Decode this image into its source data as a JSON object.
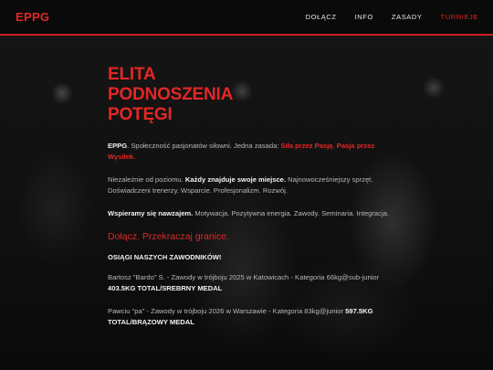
{
  "header": {
    "logo": "EPPG",
    "nav": [
      {
        "label": "DOŁĄCZ"
      },
      {
        "label": "INFO"
      },
      {
        "label": "ZASADY"
      },
      {
        "label": "TURNIEJE"
      }
    ],
    "active_nav": "TURNIEJE",
    "accent_color": "#e32726"
  },
  "hero": {
    "title_lines": [
      "ELITA",
      "PODNOSZENIA",
      "POTĘGI"
    ],
    "intro": {
      "brand": "EPPG",
      "text": ". Społeczność pasjonatów siłowni. Jedna zasada: ",
      "highlight": "Siła przez Pasję. Pasja przez Wysiłek."
    },
    "level": {
      "text_before": "Niezależnie od poziomu. ",
      "bold": "Każdy znajduje swoje miejsce.",
      "text_after": " Najnowocześniejszy sprzęt. Doświadczeni trenerzy. Wsparcie. Profesjonalizm. Rozwój."
    },
    "support": {
      "bold": "Wspieramy się nawzajem.",
      "text_after": " Motywacja. Pozytywna energia. Zawody. Seminaria. Integracja."
    },
    "tagline": "Dołącz. Przekraczaj granice.",
    "achievements_title": "OSIĄGI NASZYCH ZAWODNIKÓW!",
    "achievements": [
      {
        "text": "Bartosz \"Bardo\" S. - Zawody w trójboju 2025 w Katowicach - Kategoria 66kg@sub-junior ",
        "result": "403.5KG TOTAL/SREBRNY MEDAL"
      },
      {
        "text": "Pawciu \"pa\" - Zawody w trójboju 2026 w Warszawie - Kategoria 83kg@junior ",
        "result": "597.5KG TOTAL/BRĄZOWY MEDAL"
      }
    ]
  }
}
